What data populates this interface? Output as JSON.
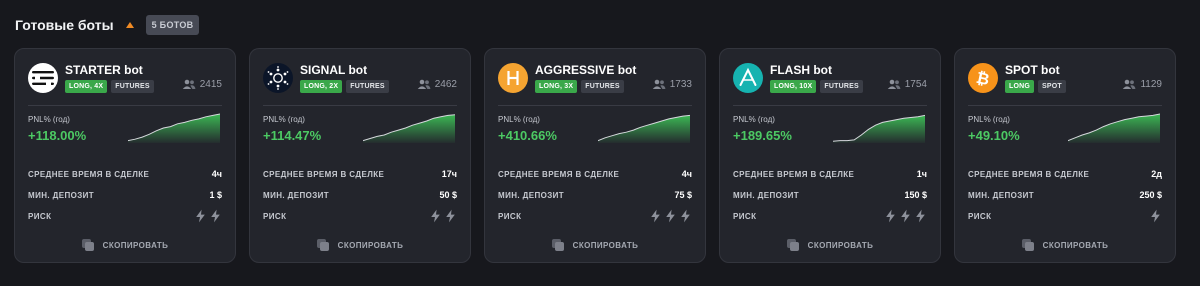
{
  "header": {
    "title": "Готовые боты",
    "badge": "5 БОТОВ"
  },
  "labels": {
    "pnl": "PNL% (год)",
    "avg_time": "СРЕДНЕЕ ВРЕМЯ В СДЕЛКЕ",
    "min_deposit": "МИН. ДЕПОЗИТ",
    "risk": "РИСК",
    "copy": "СКОПИРОВАТЬ"
  },
  "colors": {
    "accent": "#f08a24",
    "positive": "#4cc963",
    "long_tag": "#3aa84a"
  },
  "bots": [
    {
      "name": "STARTER bot",
      "icon": "starter-logo-icon",
      "tags": [
        "LONG, 4X",
        "FUTURES"
      ],
      "users": "2415",
      "pnl": "+118.00%",
      "avg_time": "4ч",
      "min_deposit": "1 $",
      "risk": 2,
      "trend": [
        2,
        4,
        7,
        11,
        16,
        20,
        22,
        26,
        28,
        31,
        33,
        36,
        38,
        40
      ]
    },
    {
      "name": "SIGNAL bot",
      "icon": "cardano-icon",
      "tags": [
        "LONG, 2X",
        "FUTURES"
      ],
      "users": "2462",
      "pnl": "+114.47%",
      "avg_time": "17ч",
      "min_deposit": "50 $",
      "risk": 2,
      "trend": [
        2,
        5,
        8,
        10,
        14,
        17,
        20,
        24,
        27,
        30,
        34,
        36,
        38,
        39
      ]
    },
    {
      "name": "AGGRESSIVE bot",
      "icon": "hedera-icon",
      "tags": [
        "LONG, 3X",
        "FUTURES"
      ],
      "users": "1733",
      "pnl": "+410.66%",
      "avg_time": "4ч",
      "min_deposit": "75 $",
      "risk": 3,
      "trend": [
        2,
        6,
        9,
        12,
        14,
        17,
        21,
        24,
        27,
        30,
        33,
        35,
        37,
        38
      ]
    },
    {
      "name": "FLASH bot",
      "icon": "arbitrum-icon",
      "tags": [
        "LONG, 10X",
        "FUTURES"
      ],
      "users": "1754",
      "pnl": "+189.65%",
      "avg_time": "1ч",
      "min_deposit": "150 $",
      "risk": 3,
      "trend": [
        1,
        2,
        2,
        3,
        10,
        18,
        24,
        28,
        30,
        32,
        34,
        35,
        36,
        38
      ]
    },
    {
      "name": "SPOT bot",
      "icon": "bitcoin-icon",
      "tags": [
        "LONG",
        "SPOT"
      ],
      "users": "1129",
      "pnl": "+49.10%",
      "avg_time": "2д",
      "min_deposit": "250 $",
      "risk": 1,
      "trend": [
        2,
        6,
        10,
        13,
        17,
        22,
        26,
        29,
        32,
        34,
        36,
        37,
        38,
        40
      ]
    }
  ]
}
